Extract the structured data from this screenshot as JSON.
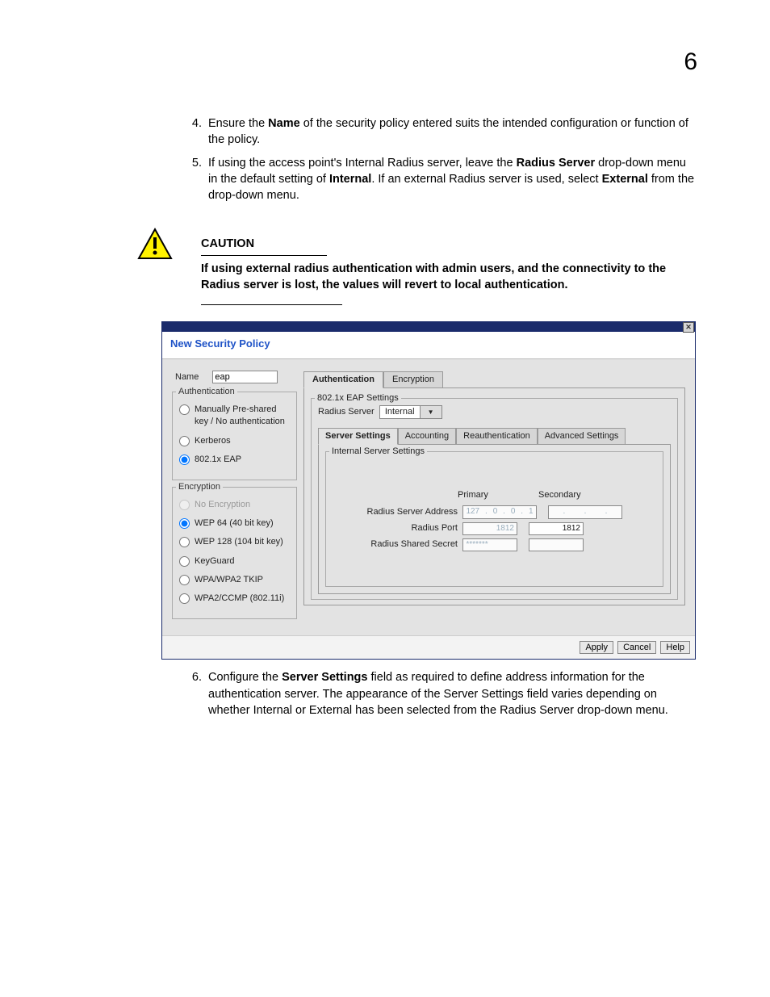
{
  "page_number": "6",
  "steps": {
    "s4_num": "4.",
    "s4": "Ensure the ",
    "s4_b": "Name",
    "s4_r": " of the security policy entered suits the intended configuration or function of the policy.",
    "s5_num": "5.",
    "s5": "If using the access point's Internal Radius server, leave the ",
    "s5_b1": "Radius Server",
    "s5_m": " drop-down menu in the default setting of ",
    "s5_b2": "Internal",
    "s5_m2": ". If an external Radius server is used, select ",
    "s5_b3": "External",
    "s5_r": " from the drop-down menu.",
    "s6_num": "6.",
    "s6": "Configure the ",
    "s6_b": "Server Settings",
    "s6_r": " field as required to define address information for the authentication server. The appearance of the Server Settings field varies depending on whether Internal or External has been selected from the Radius Server drop-down menu."
  },
  "caution": {
    "title": "CAUTION",
    "text": "If using external radius authentication with admin users, and the connectivity to the Radius server is lost, the values will revert to local authentication."
  },
  "app": {
    "title": "New Security Policy",
    "close": "✕",
    "name_label": "Name",
    "name_value": "eap",
    "auth_legend": "Authentication",
    "auth_options": [
      "Manually Pre-shared key / No authentication",
      "Kerberos",
      "802.1x EAP"
    ],
    "auth_selected": 2,
    "enc_legend": "Encryption",
    "enc_options": [
      "No Encryption",
      "WEP 64 (40 bit key)",
      "WEP 128 (104 bit key)",
      "KeyGuard",
      "WPA/WPA2 TKIP",
      "WPA2/CCMP (802.11i)"
    ],
    "enc_selected": 1,
    "enc_disabled_index": 0,
    "tabs": [
      "Authentication",
      "Encryption"
    ],
    "tabs_active": 0,
    "eap_legend": "802.1x EAP Settings",
    "radius_server_label": "Radius Server",
    "radius_server_value": "Internal",
    "subtabs": [
      "Server Settings",
      "Accounting",
      "Reauthentication",
      "Advanced Settings"
    ],
    "subtabs_active": 0,
    "server_legend": "Internal Server Settings",
    "col_primary": "Primary",
    "col_secondary": "Secondary",
    "rows": {
      "addr_label": "Radius Server Address",
      "addr_primary": [
        "127",
        "0",
        "0",
        "1"
      ],
      "addr_secondary": [
        "",
        "",
        "",
        ""
      ],
      "port_label": "Radius Port",
      "port_primary": "1812",
      "port_secondary": "1812",
      "secret_label": "Radius Shared Secret",
      "secret_primary": "*******",
      "secret_secondary": ""
    },
    "buttons": {
      "apply": "Apply",
      "cancel": "Cancel",
      "help": "Help"
    }
  }
}
